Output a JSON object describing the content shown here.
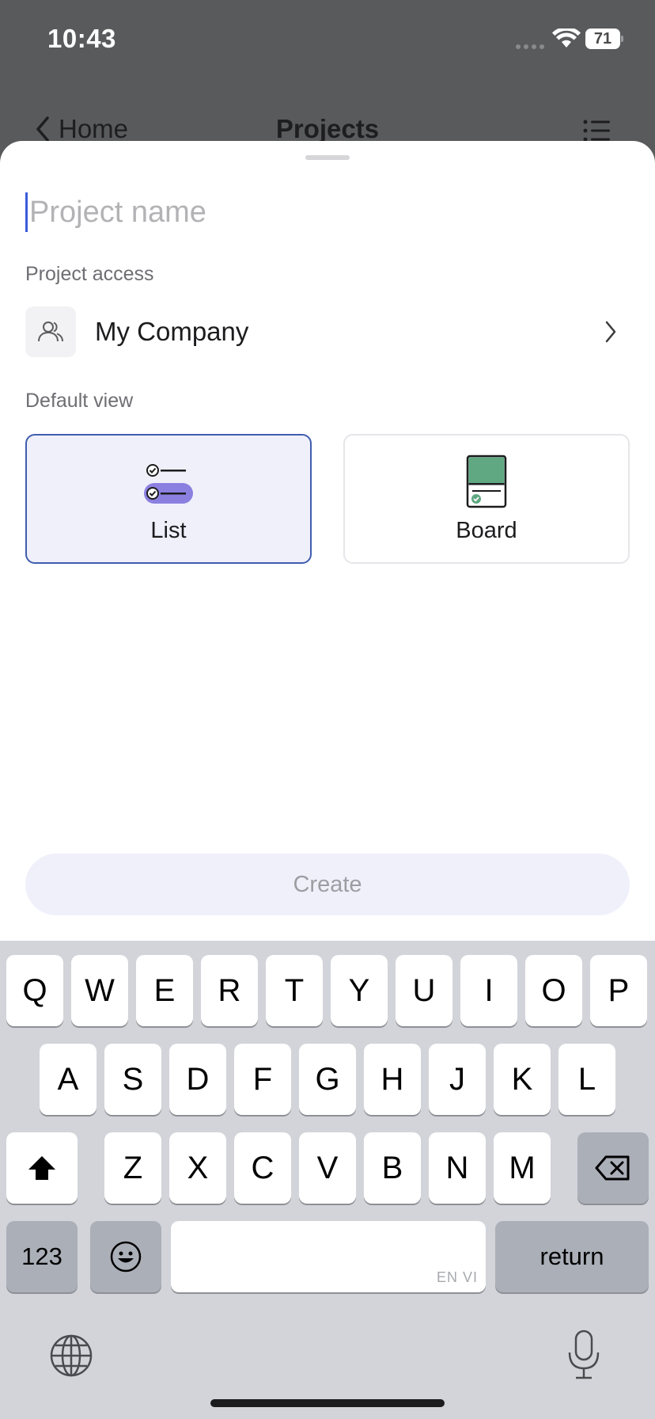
{
  "status_bar": {
    "time": "10:43",
    "battery": "71"
  },
  "nav": {
    "back_label": "Home",
    "title": "Projects"
  },
  "form": {
    "name_placeholder": "Project name",
    "access_label": "Project access",
    "access_value": "My Company",
    "view_label": "Default view",
    "views": [
      {
        "label": "List",
        "selected": true
      },
      {
        "label": "Board",
        "selected": false
      }
    ],
    "create_label": "Create"
  },
  "colors": {
    "accent": "#3f5dae",
    "list_icon_fill": "#8b80e0",
    "board_icon_fill": "#5fa882",
    "selected_card_bg": "#f0f0fb"
  },
  "keyboard": {
    "row1": [
      "Q",
      "W",
      "E",
      "R",
      "T",
      "Y",
      "U",
      "I",
      "O",
      "P"
    ],
    "row2": [
      "A",
      "S",
      "D",
      "F",
      "G",
      "H",
      "J",
      "K",
      "L"
    ],
    "row3": [
      "Z",
      "X",
      "C",
      "V",
      "B",
      "N",
      "M"
    ],
    "numbers_label": "123",
    "return_label": "return",
    "space_hint": "EN VI"
  }
}
